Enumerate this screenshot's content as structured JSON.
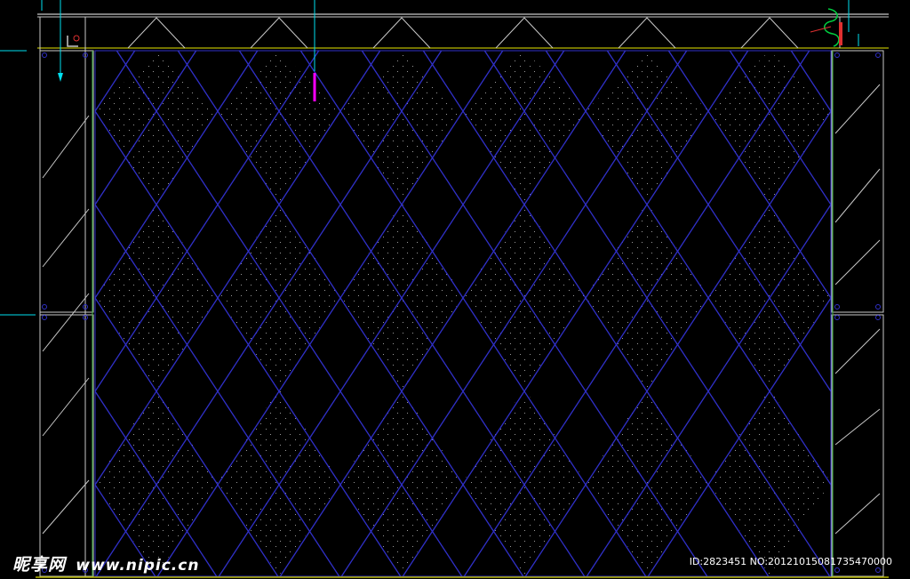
{
  "watermark": {
    "logo": "昵享网",
    "url": "www.nipic.cn"
  },
  "image_id": "ID:2823451 NO:20121015081735470000",
  "colors": {
    "background": "#000000",
    "frame_line": "#c8c8c8",
    "panel_line": "#3030c8",
    "dot_fill": "#9a9a9a",
    "jamb_green": "#3c9c3c",
    "top_beam_yellow": "#b8b800",
    "leader_cyan": "#00e0f0",
    "marker_magenta": "#ff00ff",
    "spring_green": "#00d040",
    "valve_red": "#e03030"
  },
  "drawing": {
    "diamond_columns": 6,
    "diamond_rows": 3
  }
}
